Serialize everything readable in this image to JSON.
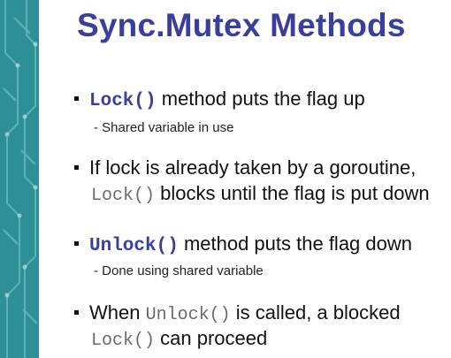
{
  "slide": {
    "title": "Sync.Mutex Methods",
    "bullets": [
      {
        "code": "Lock()",
        "text": " method puts the flag up",
        "sub": "- Shared variable in use"
      },
      {
        "text": "If lock is already taken by a goroutine,",
        "line2_code": "Lock()",
        "line2_text": " blocks until the flag is put down"
      },
      {
        "code": "Unlock()",
        "text": " method puts the flag down",
        "sub": "- Done using shared variable"
      },
      {
        "text_pre": "When ",
        "code": "Unlock()",
        "text_post": " is called, a blocked",
        "line2_code": "Lock()",
        "line2_text": " can proceed"
      }
    ]
  },
  "colors": {
    "title": "#3a3f9e",
    "code_bold": "#3a3f9e",
    "code_plain": "#6b6b6b",
    "side_strip": "#2f8f96"
  }
}
